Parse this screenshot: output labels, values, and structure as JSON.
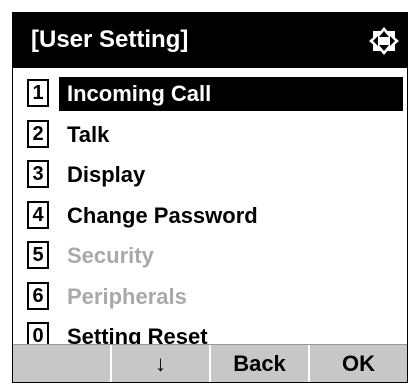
{
  "header": {
    "title": "[User Setting]",
    "nav_icon": "up-down-left-right-arrows-icon"
  },
  "menu": {
    "items": [
      {
        "number": "1",
        "label": "Incoming Call",
        "state": "selected"
      },
      {
        "number": "2",
        "label": "Talk",
        "state": "enabled"
      },
      {
        "number": "3",
        "label": "Display",
        "state": "enabled"
      },
      {
        "number": "4",
        "label": "Change Password",
        "state": "enabled"
      },
      {
        "number": "5",
        "label": "Security",
        "state": "disabled"
      },
      {
        "number": "6",
        "label": "Peripherals",
        "state": "disabled"
      },
      {
        "number": "0",
        "label": "Setting Reset",
        "state": "enabled"
      }
    ]
  },
  "softkeys": {
    "key1": "",
    "key2": "↓",
    "key3": "Back",
    "key4": "OK"
  },
  "colors": {
    "selected_bg": "#000000",
    "disabled_text": "#a9a9a9",
    "softkey_bar": "#c7c7c7"
  }
}
